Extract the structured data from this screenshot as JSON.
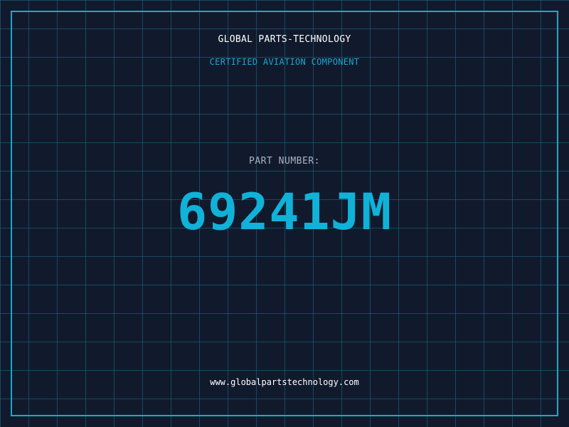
{
  "header": {
    "company": "GLOBAL PARTS-TECHNOLOGY",
    "subtitle": "CERTIFIED AVIATION COMPONENT"
  },
  "part": {
    "label": "PART NUMBER:",
    "number": "69241JM"
  },
  "footer": {
    "url": "www.globalpartstechnology.com"
  },
  "colors": {
    "background": "#111a2c",
    "grid": "#196e8c",
    "accent": "#1ba7cf",
    "part_number": "#10b2d8",
    "label": "#a9b4c2",
    "text": "#ffffff"
  }
}
